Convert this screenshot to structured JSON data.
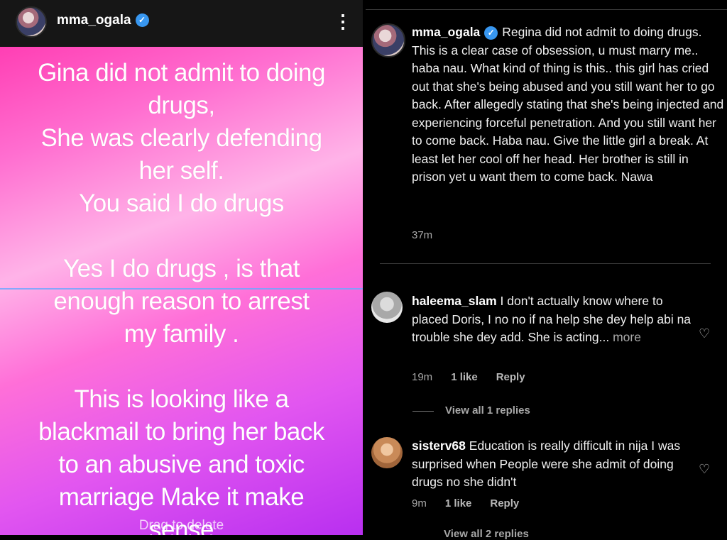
{
  "story": {
    "username": "mma_ogala",
    "verified_icon": "verified-badge-icon",
    "menu_icon": "more-vertical-icon",
    "background_colors": [
      "#ff3fb4",
      "#ffb3e8",
      "#b82ff0"
    ],
    "lines": [
      "Gina did not admit to doing",
      "drugs,",
      "She was clearly defending",
      "her self.",
      "You said I do drugs",
      "",
      "Yes I do drugs , is that",
      "enough reason to arrest",
      "my family .",
      "",
      "This is looking like a",
      "blackmail to bring her back",
      "to an abusive and toxic",
      "marriage Make it make",
      "sense"
    ],
    "drag_label": "Drag to delete"
  },
  "post": {
    "username": "mma_ogala",
    "text": "Regina did not admit to doing drugs. This is a clear case of obsession, u must marry me.. haba nau. What kind of thing is this.. this girl has cried out that she's being abused and you still want her to go back. After allegedly stating that she's being injected and experiencing forceful penetration. And you still want her to come back. Haba nau. Give the little girl a break. At least let her cool off her head. Her brother is still in prison yet u want them to come back. Nawa",
    "time": "37m"
  },
  "comments": [
    {
      "username": "haleema_slam",
      "text": "I don't actually know where to placed Doris, I no no if na help she dey help abi na trouble she dey add. She is acting...",
      "more_label": "more",
      "time": "19m",
      "likes": "1 like",
      "reply_label": "Reply",
      "view_replies": "View all 1 replies",
      "heart_icon": "heart-outline-icon"
    },
    {
      "username": "sisterv68",
      "text": "Education is really difficult in nija I was surprised when People were she admit of doing drugs no she didn't",
      "time": "9m",
      "likes": "1 like",
      "reply_label": "Reply",
      "view_replies": "View all 2 replies",
      "heart_icon": "heart-outline-icon"
    }
  ],
  "colors": {
    "verified": "#3897f0",
    "muted_text": "#a8a8a8",
    "background": "#000000"
  }
}
